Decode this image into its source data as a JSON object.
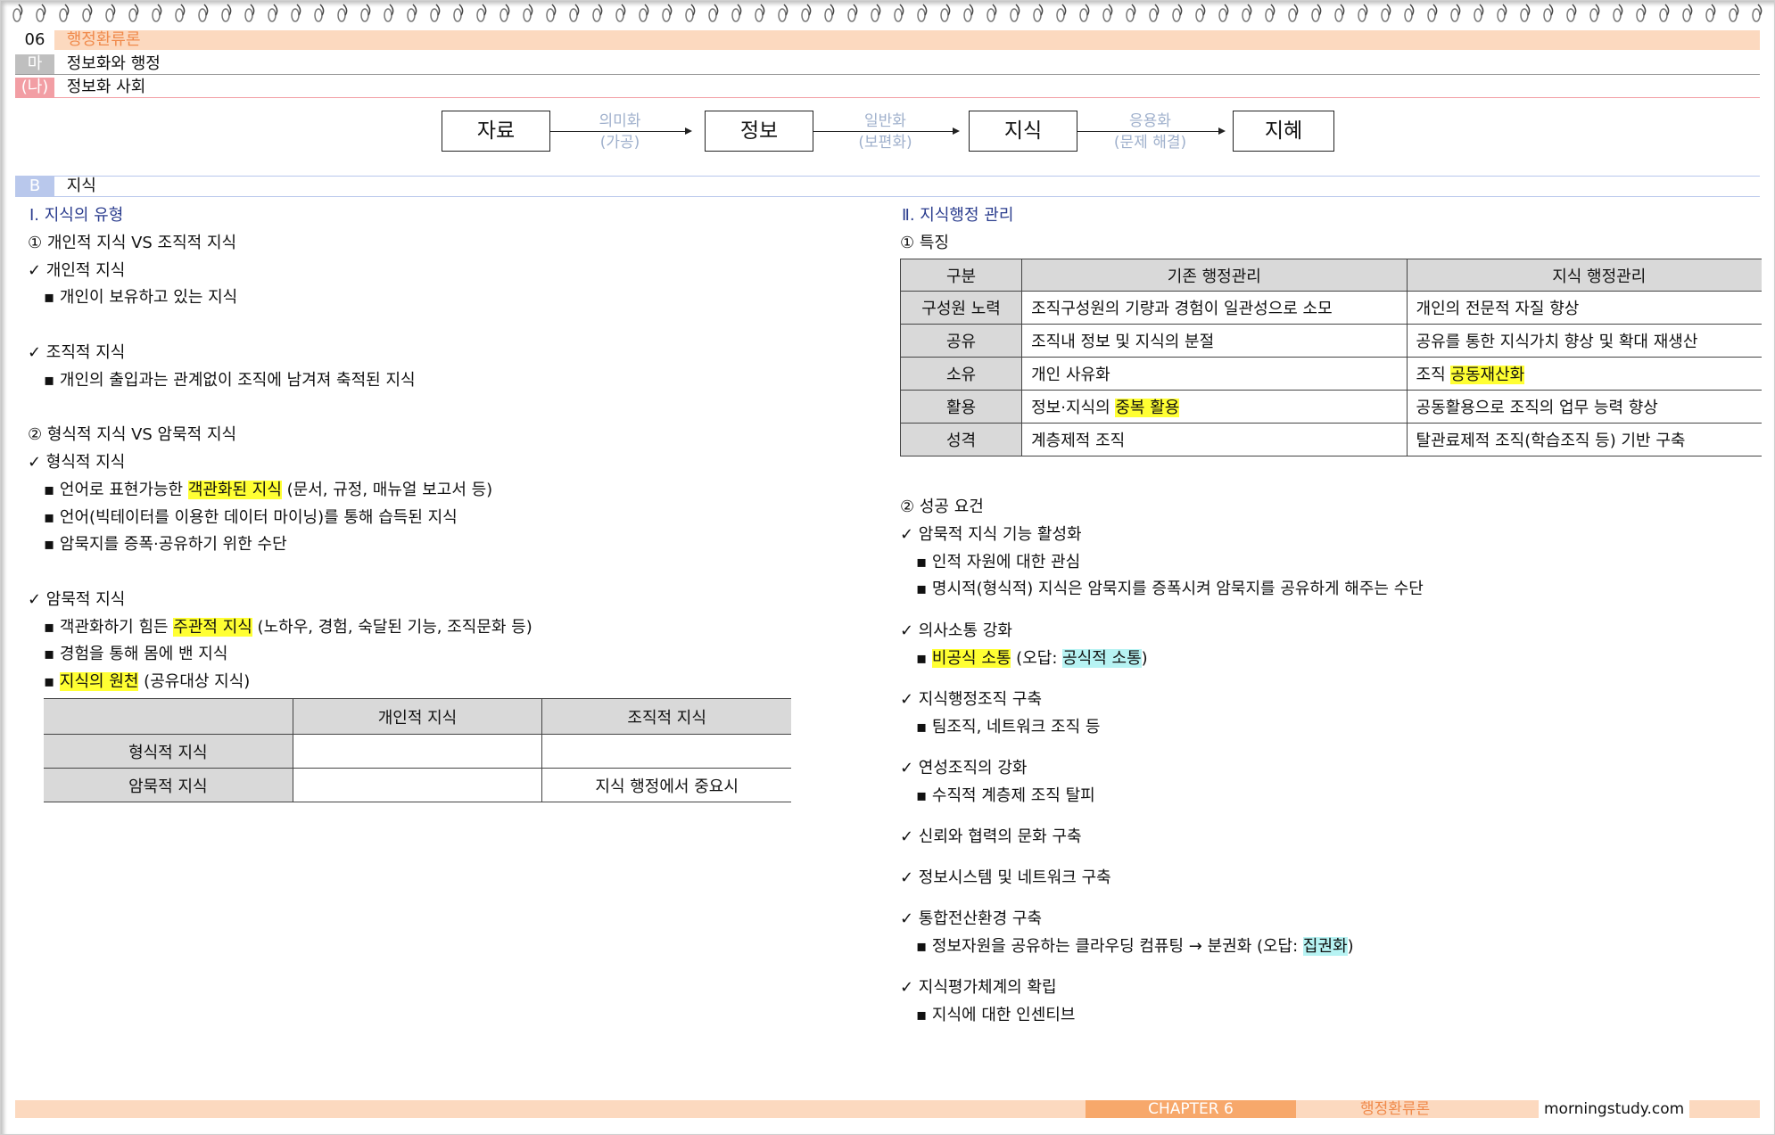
{
  "header": {
    "chapter_num": "06",
    "chapter_title": "행정환류론",
    "section_tag": "마",
    "section_title": "정보화와 행정",
    "sub_tag": "(나)",
    "sub_title": "정보화 사회"
  },
  "flow": {
    "boxes": [
      "자료",
      "정보",
      "지식",
      "지혜"
    ],
    "arrows": [
      {
        "top": "의미화",
        "bottom": "(가공)"
      },
      {
        "top": "일반화",
        "bottom": "(보편화)"
      },
      {
        "top": "응용화",
        "bottom": "(문제 해결)"
      }
    ]
  },
  "section_b": {
    "tag": "B",
    "title": "지식"
  },
  "left": {
    "heading": "Ⅰ. 지식의 유형",
    "sub1": "① 개인적 지식 VS 조직적 지식",
    "c1": "✓ 개인적 지식",
    "c1_b1": "▪ 개인이 보유하고 있는 지식",
    "c2": "✓ 조직적 지식",
    "c2_b1": "▪ 개인의 출입과는 관계없이 조직에 남겨져 축적된 지식",
    "sub2": "② 형식적 지식 VS 암묵적 지식",
    "c3": "✓ 형식적 지식",
    "c3_b1_a": "▪ 언어로 표현가능한 ",
    "c3_b1_hl": "객관화된 지식",
    "c3_b1_b": " (문서, 규정, 매뉴얼 보고서 등)",
    "c3_b2": "▪ 언어(빅테이터를 이용한 데이터 마이닝)를 통해 습득된 지식",
    "c3_b3": "▪ 암묵지를 증폭·공유하기 위한 수단",
    "c4": "✓ 암묵적 지식",
    "c4_b1_a": "▪ 객관화하기 힘든 ",
    "c4_b1_hl": "주관적 지식",
    "c4_b1_b": " (노하우, 경험, 숙달된 기능, 조직문화 등)",
    "c4_b2": "▪ 경험을 통해 몸에 밴 지식",
    "c4_b3_a": "▪ ",
    "c4_b3_hl": "지식의 원천",
    "c4_b3_b": " (공유대상 지식)",
    "table": {
      "headers": [
        "",
        "개인적 지식",
        "조직적 지식"
      ],
      "rows": [
        [
          "형식적 지식",
          "",
          ""
        ],
        [
          "암묵적 지식",
          "",
          "지식 행정에서 중요시"
        ]
      ]
    }
  },
  "right": {
    "heading": "Ⅱ. 지식행정 관리",
    "sub1": "① 특징",
    "table": {
      "headers": [
        "구분",
        "기존 행정관리",
        "지식 행정관리"
      ],
      "rows": [
        {
          "h": "구성원 노력",
          "a": "조직구성원의 기량과 경험이 일관성으로 소모",
          "b": "개인의 전문적 자질 향상"
        },
        {
          "h": "공유",
          "a": "조직내 정보 및 지식의 분절",
          "b": "공유를 통한 지식가치 향상 및 확대 재생산"
        },
        {
          "h": "소유",
          "a": "개인 사유화",
          "b_a": "조직 ",
          "b_hl": "공동재산화"
        },
        {
          "h": "활용",
          "a_a": "정보·지식의 ",
          "a_hl": "중복 활용",
          "b": "공동활용으로 조직의 업무 능력 향상"
        },
        {
          "h": "성격",
          "a": "계층제적 조직",
          "b": "탈관료제적 조직(학습조직 등) 기반 구축"
        }
      ]
    },
    "sub2": "② 성공 요건",
    "r1": "✓ 암묵적 지식 기능 활성화",
    "r1_b1": "▪ 인적 자원에 대한 관심",
    "r1_b2": "▪ 명시적(형식적) 지식은 암묵지를 증폭시켜 암묵지를 공유하게 해주는 수단",
    "r2": "✓ 의사소통 강화",
    "r2_b1_a": "▪ ",
    "r2_b1_hl": "비공식 소통",
    "r2_b1_b": " (오답: ",
    "r2_b1_hl2": "공식적 소통",
    "r2_b1_c": ")",
    "r3": "✓ 지식행정조직 구축",
    "r3_b1": "▪ 팀조직, 네트워크 조직 등",
    "r4": "✓ 연성조직의 강화",
    "r4_b1": "▪ 수직적 계층제 조직 탈피",
    "r5": "✓ 신뢰와 협력의 문화 구축",
    "r6": "✓ 정보시스템 및 네트워크 구축",
    "r7": "✓ 통합전산환경 구축",
    "r7_b1_a": "▪ 정보자원을 공유하는 클라우딩 컴퓨팅 → 분권화 (오답: ",
    "r7_b1_hl": "집권화",
    "r7_b1_b": ")",
    "r8": "✓ 지식평가체계의 확립",
    "r8_b1": "▪ 지식에 대한 인센티브"
  },
  "footer": {
    "chapter": "CHAPTER 6",
    "title": "행정환류론",
    "site": "morningstudy.com"
  },
  "colors": {
    "peach": "#fcd9bf",
    "chapter_orange": "#f7a86b",
    "pink_tag": "#f29ea4",
    "blue_tag": "#b9c8ec",
    "gray_tag": "#bfbfbf",
    "highlight_yellow": "#ffff33",
    "highlight_cyan": "#b7f3f3"
  }
}
